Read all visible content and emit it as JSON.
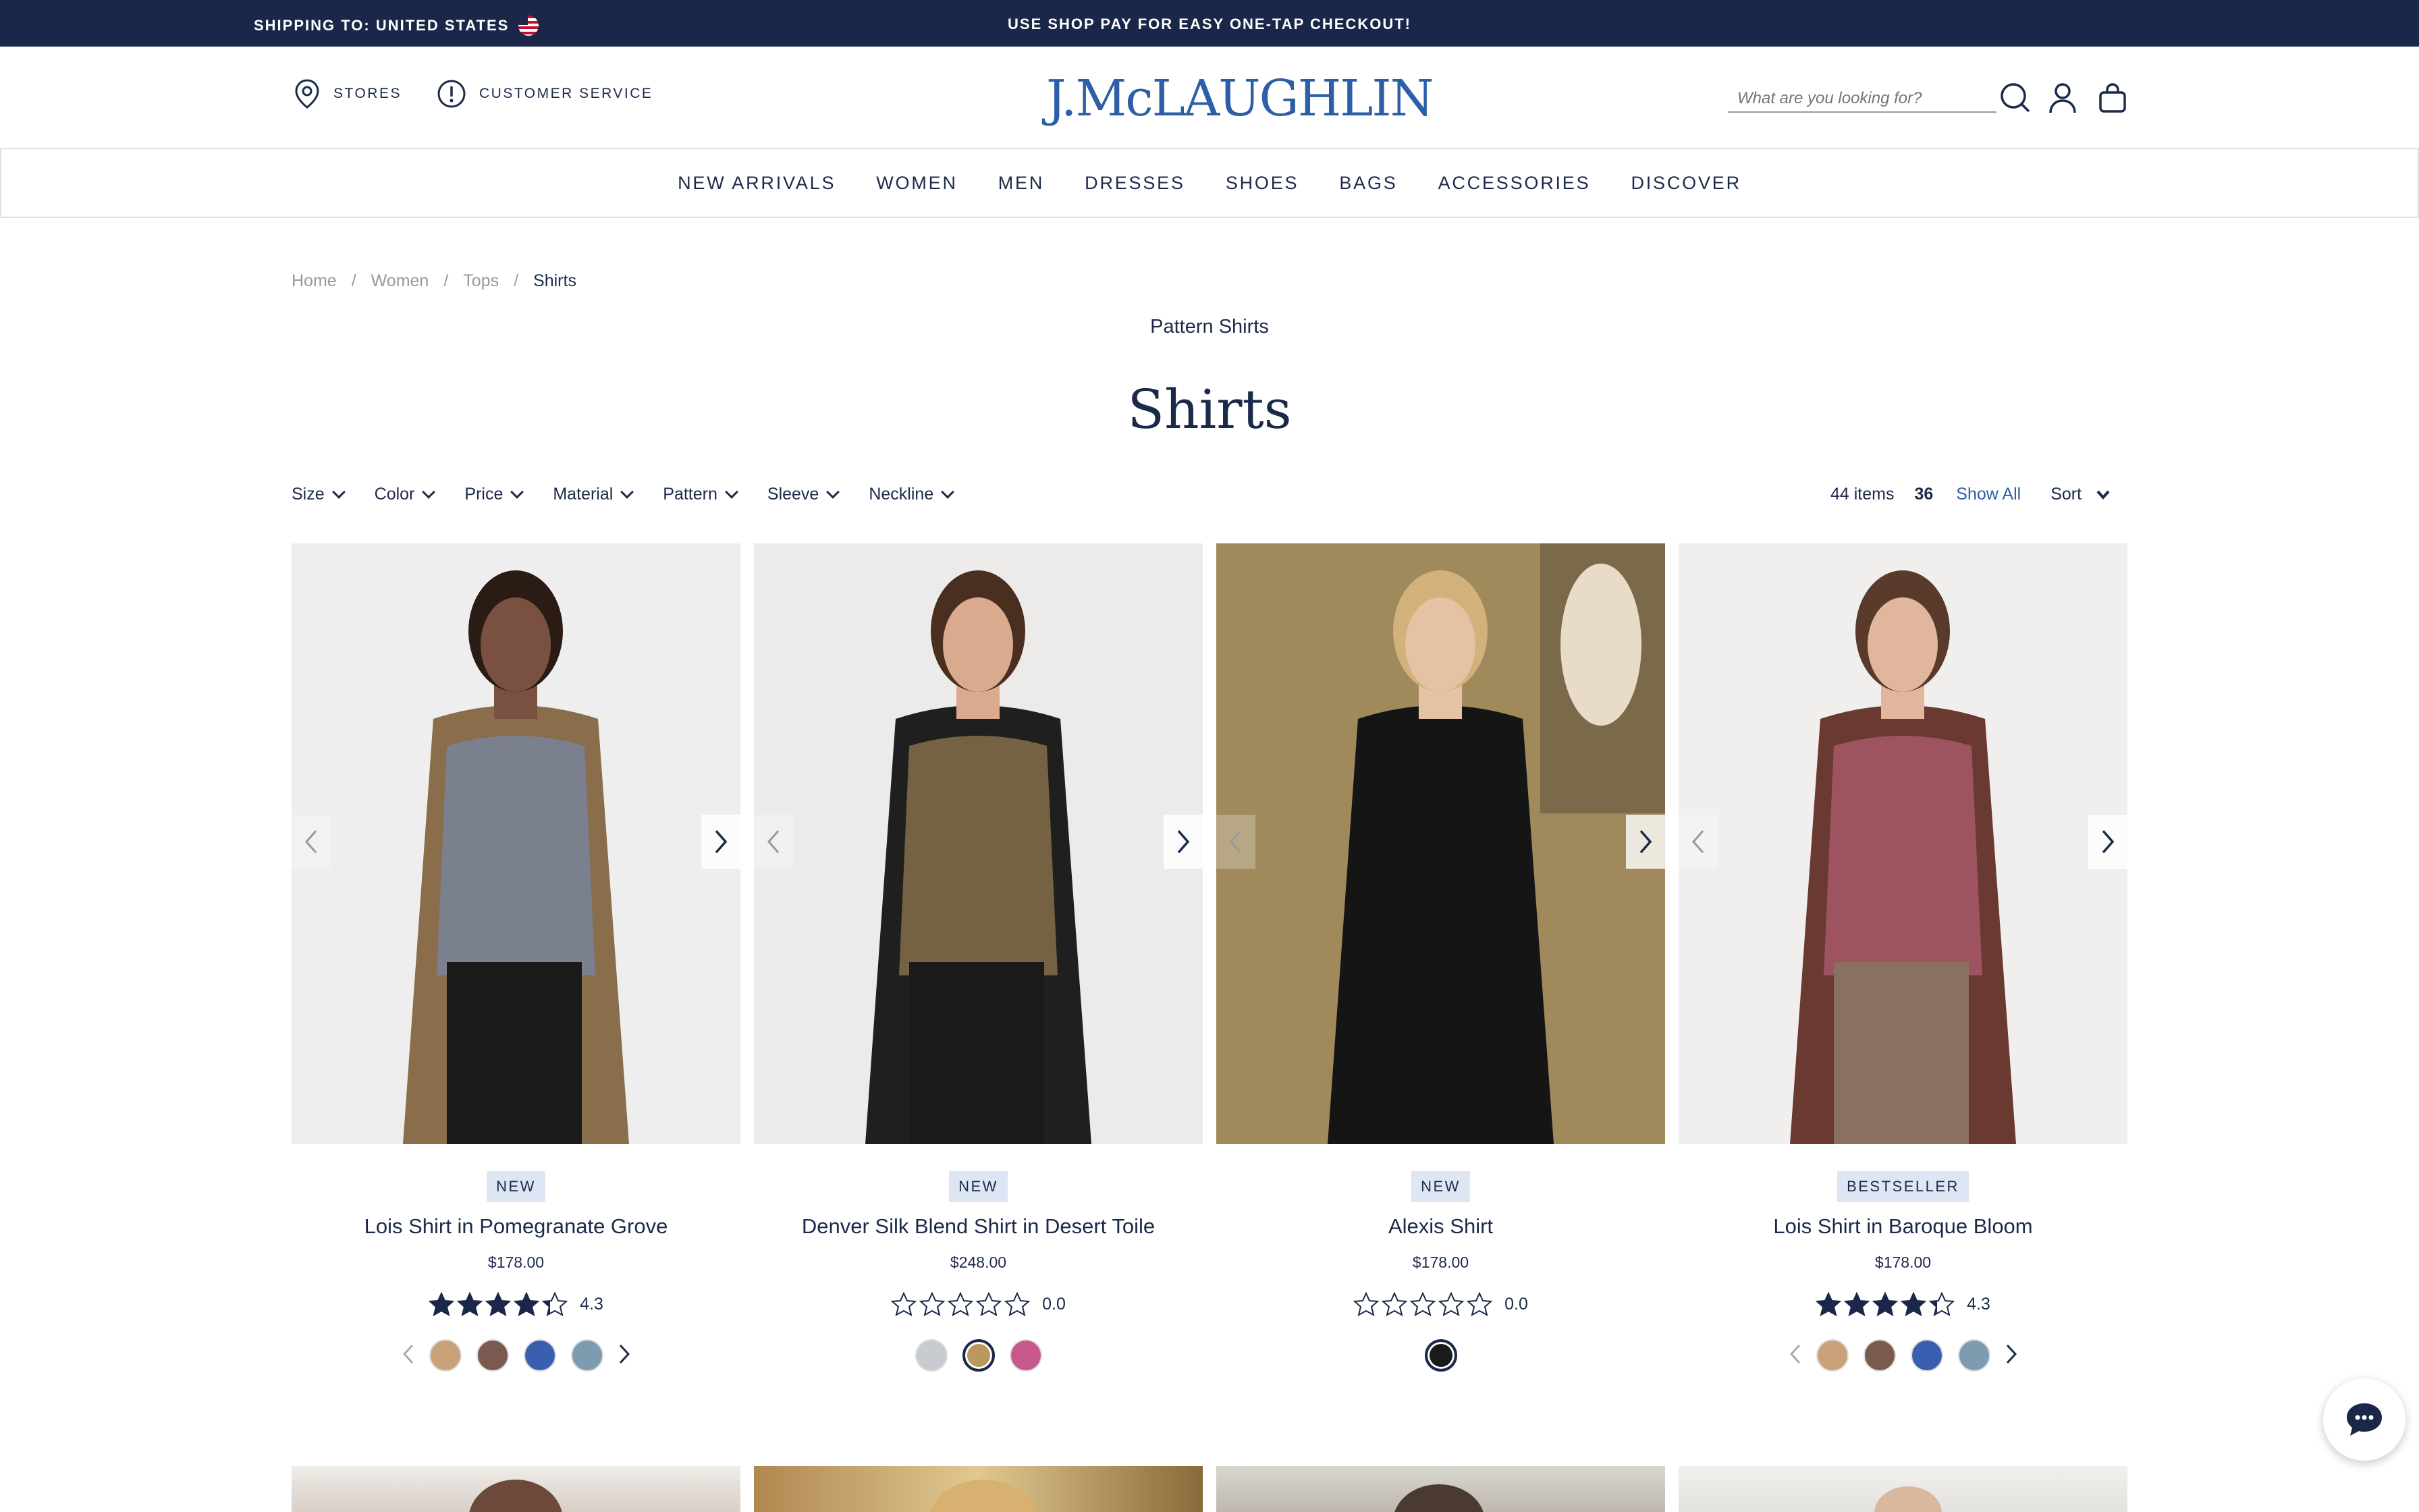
{
  "topbar": {
    "shipping": "SHIPPING TO: UNITED STATES",
    "promo": "USE SHOP PAY FOR EASY ONE-TAP CHECKOUT!"
  },
  "header": {
    "stores": "STORES",
    "service": "CUSTOMER SERVICE",
    "logo": "J.McLAUGHLIN",
    "search_placeholder": "What are you looking for?"
  },
  "nav": [
    "NEW ARRIVALS",
    "WOMEN",
    "MEN",
    "DRESSES",
    "SHOES",
    "BAGS",
    "ACCESSORIES",
    "DISCOVER"
  ],
  "breadcrumb": {
    "home": "Home",
    "women": "Women",
    "tops": "Tops",
    "current": "Shirts",
    "sep": "/"
  },
  "page": {
    "subtitle": "Pattern Shirts",
    "title": "Shirts"
  },
  "filters": [
    "Size",
    "Color",
    "Price",
    "Material",
    "Pattern",
    "Sleeve",
    "Neckline"
  ],
  "results": {
    "items": "44 items",
    "per_page": "36",
    "show_all": "Show All",
    "sort": "Sort"
  },
  "products": [
    {
      "badge": "NEW",
      "name": "Lois Shirt in Pomegranate Grove",
      "price": "$178.00",
      "rating": "4.3",
      "stars": 4.3,
      "swatches": [
        "#c9a27a",
        "#7a5a4e",
        "#3a5fb0",
        "#7f9bb0"
      ],
      "selected": -1,
      "has_swatch_arrows": true
    },
    {
      "badge": "NEW",
      "name": "Denver Silk Blend Shirt in Desert Toile",
      "price": "$248.00",
      "rating": "0.0",
      "stars": 0,
      "swatches": [
        "#c8ccd1",
        "#b9995e",
        "#c7588e"
      ],
      "selected": 1,
      "has_swatch_arrows": false
    },
    {
      "badge": "NEW",
      "name": "Alexis Shirt",
      "price": "$178.00",
      "rating": "0.0",
      "stars": 0,
      "swatches": [
        "#1a1a1a"
      ],
      "selected": 0,
      "has_swatch_arrows": false
    },
    {
      "badge": "BESTSELLER",
      "name": "Lois Shirt in Baroque Bloom",
      "price": "$178.00",
      "rating": "4.3",
      "stars": 4.3,
      "swatches": [
        "#c9a27a",
        "#7a5a4e",
        "#3a5fb0",
        "#7f9bb0"
      ],
      "selected": -1,
      "has_swatch_arrows": true
    }
  ],
  "colors": {
    "navy": "#1a2748",
    "accent": "#2d5ea8",
    "badge_bg": "#dde6f2"
  }
}
